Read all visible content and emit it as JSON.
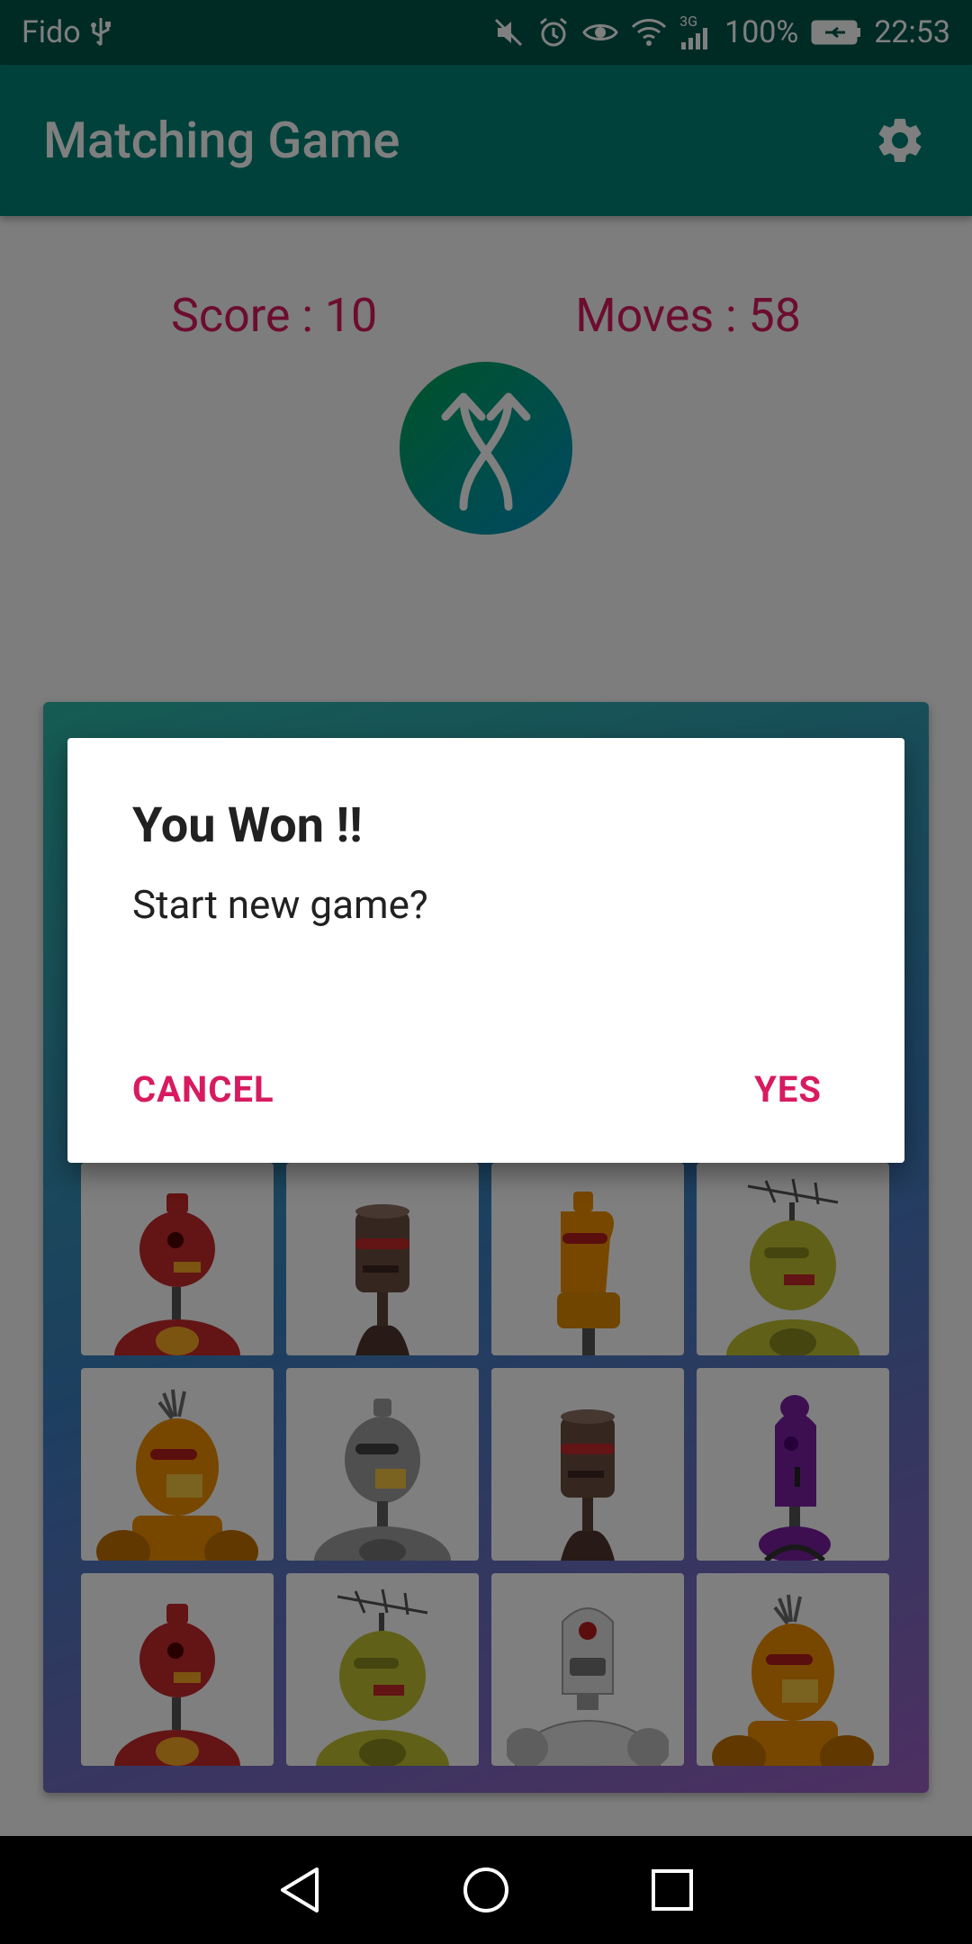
{
  "status_bar": {
    "carrier": "Fido",
    "network_type": "3G",
    "battery": "100%",
    "time": "22:53",
    "icons": [
      "usb-icon",
      "mute-icon",
      "alarm-icon",
      "eye-icon",
      "wifi-icon",
      "signal-icon",
      "battery-icon"
    ]
  },
  "app_bar": {
    "title": "Matching Game",
    "settings_icon": "gear-icon"
  },
  "score": {
    "score_text": "Score : 10",
    "moves_text": "Moves : 58"
  },
  "shuffle_button": {
    "icon": "shuffle-arrows-icon"
  },
  "board": {
    "tiles": [
      "red-robot",
      "brown-robot",
      "orange-robot",
      "yellow-antenna-robot",
      "orange-spiky-robot",
      "gray-robot",
      "brown-robot",
      "purple-robot",
      "red-robot",
      "yellow-antenna-robot",
      "white-robot",
      "orange-spiky-robot"
    ]
  },
  "dialog": {
    "title": "You Won !!",
    "message": "Start new game?",
    "cancel_label": "CANCEL",
    "yes_label": "YES"
  },
  "nav_bar": {
    "icons": [
      "back-triangle-icon",
      "home-circle-icon",
      "recents-square-icon"
    ]
  },
  "colors": {
    "primary": "#008577",
    "primary_dark": "#00574b",
    "accent": "#d81b60"
  }
}
